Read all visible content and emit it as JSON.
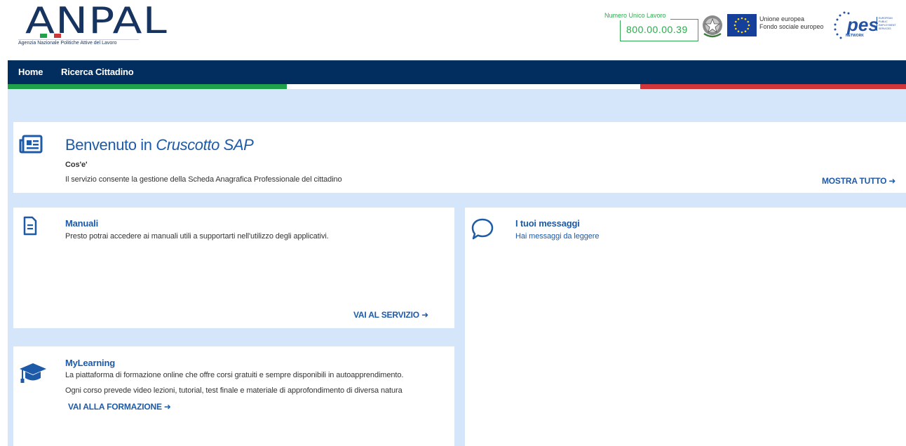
{
  "header": {
    "logo_text": "ANPAL",
    "logo_subtitle": "Agenzia Nazionale Politiche Attive del Lavoro",
    "numero_label": "Numero Unico Lavoro",
    "numero_value": "800.00.00.39",
    "eu_line1": "Unione europea",
    "eu_line2": "Fondo sociale europeo",
    "pes_text": "pes",
    "pes_network": "NETWORK",
    "pes_side": "EUROPEAN PUBLIC EMPLOYMENT SERVICES"
  },
  "nav": {
    "items": [
      {
        "label": "Home"
      },
      {
        "label": "Ricerca Cittadino"
      }
    ]
  },
  "welcome": {
    "title_prefix": "Benvenuto in ",
    "title_app": "Cruscotto SAP",
    "subtitle": "Cos'e'",
    "description": "Il servizio consente la gestione della Scheda Anagrafica Professionale del cittadino",
    "link": "MOSTRA TUTTO"
  },
  "manuali": {
    "title": "Manuali",
    "description": "Presto potrai accedere ai manuali utili a supportarti nell'utilizzo degli applicativi.",
    "link": "VAI AL SERVIZIO"
  },
  "messaggi": {
    "title": "I tuoi messaggi",
    "subtitle": "Hai messaggi da leggere"
  },
  "mylearning": {
    "title": "MyLearning",
    "line1": "La piattaforma di formazione online che offre corsi gratuiti e sempre disponibili in autoapprendimento.",
    "line2": "Ogni corso prevede video lezioni, tutorial, test finale e materiale di approfondimento di diversa natura",
    "link": "VAI ALLA FORMAZIONE"
  },
  "colors": {
    "nav_bg": "#012e5e",
    "accent": "#1d5aa8",
    "page_bg": "#d5e6fb",
    "green": "#1fa24a",
    "red": "#d0353a"
  },
  "icons": [
    "news-icon",
    "document-icon",
    "chat-bubble-icon",
    "graduation-cap-icon",
    "arrow-right-icon"
  ]
}
